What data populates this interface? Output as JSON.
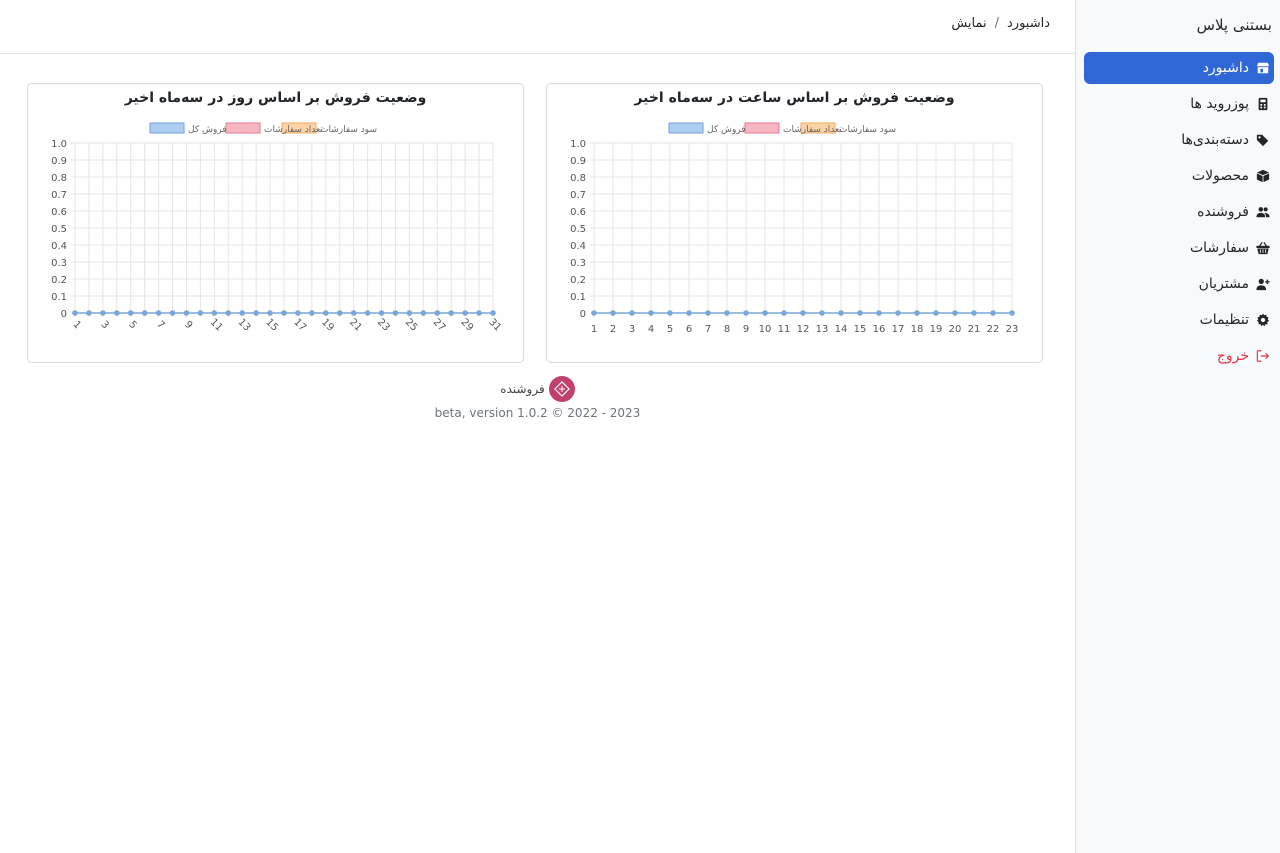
{
  "brand": "بستنی پلاس",
  "breadcrumb": {
    "home": "داشبورد",
    "separator": "/",
    "current": "نمایش"
  },
  "sidebar": {
    "items": [
      {
        "label": "داشبورد",
        "icon": "store-icon",
        "active": true
      },
      {
        "label": "پوزروید ها",
        "icon": "calculator-icon",
        "active": false
      },
      {
        "label": "دسته‌بندی‌ها",
        "icon": "tags-icon",
        "active": false
      },
      {
        "label": "محصولات",
        "icon": "box-icon",
        "active": false
      },
      {
        "label": "فروشنده",
        "icon": "users-icon",
        "active": false
      },
      {
        "label": "سفارشات",
        "icon": "basket-icon",
        "active": false
      },
      {
        "label": "مشتریان",
        "icon": "user-plus-icon",
        "active": false
      },
      {
        "label": "تنظیمات",
        "icon": "gear-icon",
        "active": false
      }
    ],
    "logout": {
      "label": "خروج",
      "icon": "logout-icon"
    }
  },
  "colors": {
    "accent": "#2f67d7",
    "danger": "#dc3545",
    "series_line": "#7aa6da",
    "legend_total": "#aecdf0",
    "legend_orders": "#f6b6c4",
    "legend_profit": "#fcd3a6"
  },
  "chart_data": [
    {
      "type": "line",
      "title": "وضعیت فروش بر اساس ساعت در سه‌ماه اخیر",
      "legend": [
        "سود سفارشات",
        "تعداد سفارشات",
        "فروش کل"
      ],
      "x": [
        1,
        2,
        3,
        4,
        5,
        6,
        7,
        8,
        9,
        10,
        11,
        12,
        13,
        14,
        15,
        16,
        17,
        18,
        19,
        20,
        21,
        22,
        23
      ],
      "x_tick_labels": [
        "1",
        "2",
        "3",
        "4",
        "5",
        "6",
        "7",
        "8",
        "9",
        "10",
        "11",
        "12",
        "13",
        "14",
        "15",
        "16",
        "17",
        "18",
        "19",
        "20",
        "21",
        "22",
        "23"
      ],
      "y_tick_labels": [
        "0",
        "0.1",
        "0.2",
        "0.3",
        "0.4",
        "0.5",
        "0.6",
        "0.7",
        "0.8",
        "0.9",
        "1.0"
      ],
      "ylim": [
        0,
        1
      ],
      "grid": true,
      "legend_position": "top",
      "series": [
        {
          "name": "فروش کل",
          "values": [
            0,
            0,
            0,
            0,
            0,
            0,
            0,
            0,
            0,
            0,
            0,
            0,
            0,
            0,
            0,
            0,
            0,
            0,
            0,
            0,
            0,
            0,
            0
          ]
        }
      ]
    },
    {
      "type": "line",
      "title": "وضعیت فروش بر اساس روز در سه‌ماه اخیر",
      "legend": [
        "سود سفارشات",
        "تعداد سفارشات",
        "فروش کل"
      ],
      "x": [
        1,
        2,
        3,
        4,
        5,
        6,
        7,
        8,
        9,
        10,
        11,
        12,
        13,
        14,
        15,
        16,
        17,
        18,
        19,
        20,
        21,
        22,
        23,
        24,
        25,
        26,
        27,
        28,
        29,
        30,
        31
      ],
      "x_tick_labels": [
        "1",
        "3",
        "5",
        "7",
        "9",
        "11",
        "13",
        "15",
        "17",
        "19",
        "21",
        "23",
        "25",
        "27",
        "29",
        "31"
      ],
      "y_tick_labels": [
        "0",
        "0.1",
        "0.2",
        "0.3",
        "0.4",
        "0.5",
        "0.6",
        "0.7",
        "0.8",
        "0.9",
        "1.0"
      ],
      "ylim": [
        0,
        1
      ],
      "grid": true,
      "legend_position": "top",
      "series": [
        {
          "name": "فروش کل",
          "values": [
            0,
            0,
            0,
            0,
            0,
            0,
            0,
            0,
            0,
            0,
            0,
            0,
            0,
            0,
            0,
            0,
            0,
            0,
            0,
            0,
            0,
            0,
            0,
            0,
            0,
            0,
            0,
            0,
            0,
            0,
            0
          ]
        }
      ]
    }
  ],
  "footer": {
    "brand": "فروشنده",
    "version": "beta, version 1.0.2 © 2022 - 2023"
  }
}
